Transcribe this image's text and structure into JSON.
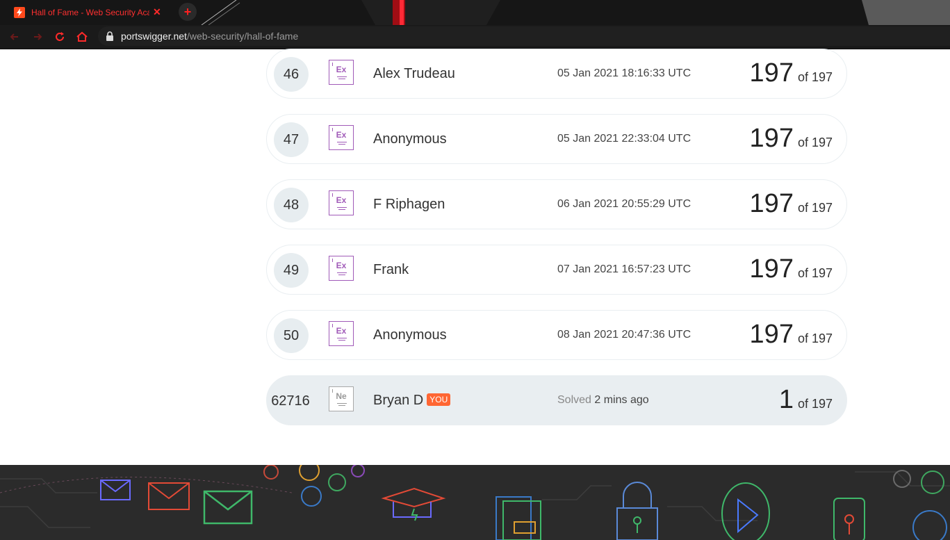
{
  "browser": {
    "tab_title": "Hall of Fame - Web Security Academy",
    "tab_close": "✕",
    "new_tab": "+",
    "url_host": "portswigger.net",
    "url_path": "/web-security/hall-of-fame"
  },
  "leaderboard": {
    "rows": [
      {
        "rank": "46",
        "level": "Ex",
        "name": "Alex Trudeau",
        "time": "05 Jan 2021 18:16:33 UTC",
        "score": "197",
        "of": "of 197"
      },
      {
        "rank": "47",
        "level": "Ex",
        "name": "Anonymous",
        "time": "05 Jan 2021 22:33:04 UTC",
        "score": "197",
        "of": "of 197"
      },
      {
        "rank": "48",
        "level": "Ex",
        "name": "F Riphagen",
        "time": "06 Jan 2021 20:55:29 UTC",
        "score": "197",
        "of": "of 197"
      },
      {
        "rank": "49",
        "level": "Ex",
        "name": "Frank",
        "time": "07 Jan 2021 16:57:23 UTC",
        "score": "197",
        "of": "of 197"
      },
      {
        "rank": "50",
        "level": "Ex",
        "name": "Anonymous",
        "time": "08 Jan 2021 20:47:36 UTC",
        "score": "197",
        "of": "of 197"
      }
    ],
    "me": {
      "rank": "62716",
      "level": "Ne",
      "name": "Bryan D",
      "badge": "YOU",
      "solved_label": "Solved",
      "time": "2 mins ago",
      "score": "1",
      "of": "of 197"
    }
  },
  "colors": {
    "accent": "#ff6633",
    "expert": "#a05ab8",
    "row_highlight": "#e9eef1"
  }
}
